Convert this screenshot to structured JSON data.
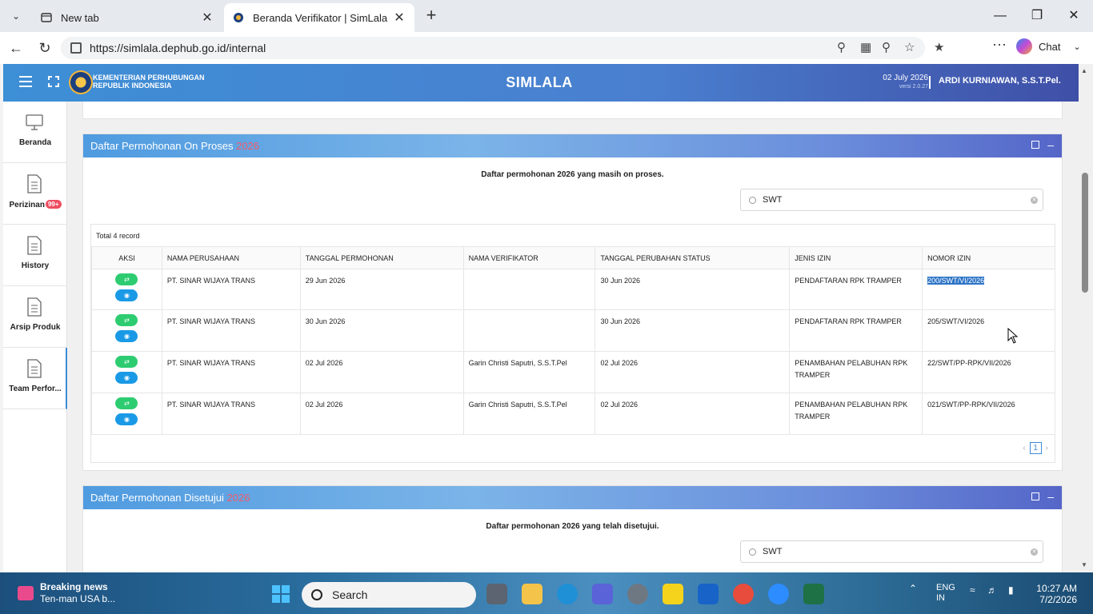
{
  "browser": {
    "tabs": [
      {
        "label": "New tab"
      },
      {
        "label": "Beranda Verifikator | SimLala"
      }
    ],
    "url": "https://simlala.dephub.go.id/internal",
    "chat_label": "Chat"
  },
  "header": {
    "ministry_line1": "KEMENTERIAN PERHUBUNGAN",
    "ministry_line2": "REPUBLIK INDONESIA",
    "app_title": "SIMLALA",
    "date": "02 July 2026",
    "version": "versi 2.0.27",
    "user": "ARDI KURNIAWAN, S.S.T.Pel."
  },
  "sidebar": {
    "items": [
      {
        "label": "Beranda",
        "icon": "monitor-icon"
      },
      {
        "label": "Perizinan",
        "icon": "document-icon",
        "badge": "99+"
      },
      {
        "label": "History",
        "icon": "document-icon"
      },
      {
        "label": "Arsip Produk",
        "icon": "document-icon"
      },
      {
        "label": "Team Perfor...",
        "icon": "document-icon"
      }
    ]
  },
  "panel_onproses": {
    "title": "Daftar Permohonan On Proses",
    "year": "2026",
    "description": "Daftar permohonan 2026 yang masih on proses.",
    "search_value": "SWT",
    "total": "Total 4 record",
    "columns": [
      "AKSI",
      "NAMA PERUSAHAAN",
      "TANGGAL PERMOHONAN",
      "NAMA VERIFIKATOR",
      "TANGGAL PERUBAHAN STATUS",
      "JENIS IZIN",
      "NOMOR IZIN"
    ],
    "rows": [
      {
        "perusahaan": "PT. SINAR WIJAYA TRANS",
        "tgl_permohonan": "29 Jun 2026",
        "verifikator": "",
        "tgl_status": "30 Jun 2026",
        "jenis": "PENDAFTARAN RPK TRAMPER",
        "nomor": "200/SWT/VI/2026"
      },
      {
        "perusahaan": "PT. SINAR WIJAYA TRANS",
        "tgl_permohonan": "30 Jun 2026",
        "verifikator": "",
        "tgl_status": "30 Jun 2026",
        "jenis": "PENDAFTARAN RPK TRAMPER",
        "nomor": "205/SWT/VI/2026"
      },
      {
        "perusahaan": "PT. SINAR WIJAYA TRANS",
        "tgl_permohonan": "02 Jul 2026",
        "verifikator": "Garin Christi Saputri, S.S.T.Pel",
        "tgl_status": "02 Jul 2026",
        "jenis": "PENAMBAHAN PELABUHAN RPK TRAMPER",
        "nomor": "22/SWT/PP-RPK/VII/2026"
      },
      {
        "perusahaan": "PT. SINAR WIJAYA TRANS",
        "tgl_permohonan": "02 Jul 2026",
        "verifikator": "Garin Christi Saputri, S.S.T.Pel",
        "tgl_status": "02 Jul 2026",
        "jenis": "PENAMBAHAN PELABUHAN RPK TRAMPER",
        "nomor": "021/SWT/PP-RPK/VII/2026"
      }
    ],
    "page": "1"
  },
  "panel_disetujui": {
    "title": "Daftar Permohonan Disetujui",
    "year": "2026",
    "description": "Daftar permohonan 2026 yang telah disetujui.",
    "search_value": "SWT"
  },
  "taskbar": {
    "news_title": "Breaking news",
    "news_sub": "Ten-man USA b...",
    "search_label": "Search",
    "lang": "ENG",
    "lang_sub": "IN",
    "time": "10:27 AM",
    "date": "7/2/2026"
  },
  "colors": {
    "accent_blue": "#3e8bd4",
    "year_red": "#f25a6a",
    "action_green": "#2ecc71",
    "action_blue": "#1a9ae6"
  }
}
